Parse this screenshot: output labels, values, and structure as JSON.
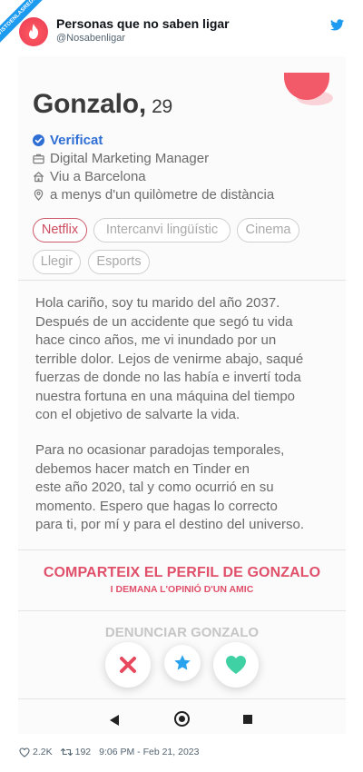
{
  "tweet": {
    "display_name": "Personas que no saben ligar",
    "handle": "@Nosabenligar",
    "corner_banner": "VISTOENLASREDES",
    "likes": "2.2K",
    "retweets": "192",
    "timestamp": "9:06 PM - Feb 21, 2023",
    "brand_color": "#1d9bf0"
  },
  "profile": {
    "name": "Gonzalo,",
    "age": "29",
    "verified": "Verificat",
    "job": "Digital Marketing Manager",
    "city": "Viu a Barcelona",
    "distance": "a menys d'un quilòmetre de distància",
    "interests": [
      {
        "label": "Netflix",
        "active": true
      },
      {
        "label": "Intercanvi lingüístic",
        "active": false
      },
      {
        "label": "Cinema",
        "active": false
      },
      {
        "label": "Llegir",
        "active": false
      },
      {
        "label": "Esports",
        "active": false
      }
    ],
    "bio": [
      "Hola cariño, soy tu marido del año 2037.",
      "Después de un accidente que segó tu vida",
      "hace cinco años, me vi inundado por un",
      "terrible dolor. Lejos de venirme abajo, saqué",
      "fuerzas de donde no las había e invertí toda",
      "nuestra fortuna en una máquina del tiempo",
      "con el objetivo de salvarte la vida.",
      "Para no ocasionar paradojas temporales,",
      "debemos hacer match en Tinder en",
      "este año 2020, tal y como ocurrió en su",
      "momento. Espero que hagas lo correcto",
      "para ti, por mí y para el destino del universo."
    ],
    "share_title": "COMPARTEIX EL PERFIL DE GONZALO",
    "share_subtitle": "I DEMANA L'OPINIÓ D'UN AMIC",
    "report": "DENUNCIAR GONZALO",
    "accent_color": "#e0506a"
  },
  "actions": {
    "icons": [
      "close-icon",
      "star-icon",
      "heart-icon"
    ]
  },
  "navbar": {
    "icons": [
      "back-triangle-icon",
      "home-circle-icon",
      "recents-square-icon"
    ]
  }
}
